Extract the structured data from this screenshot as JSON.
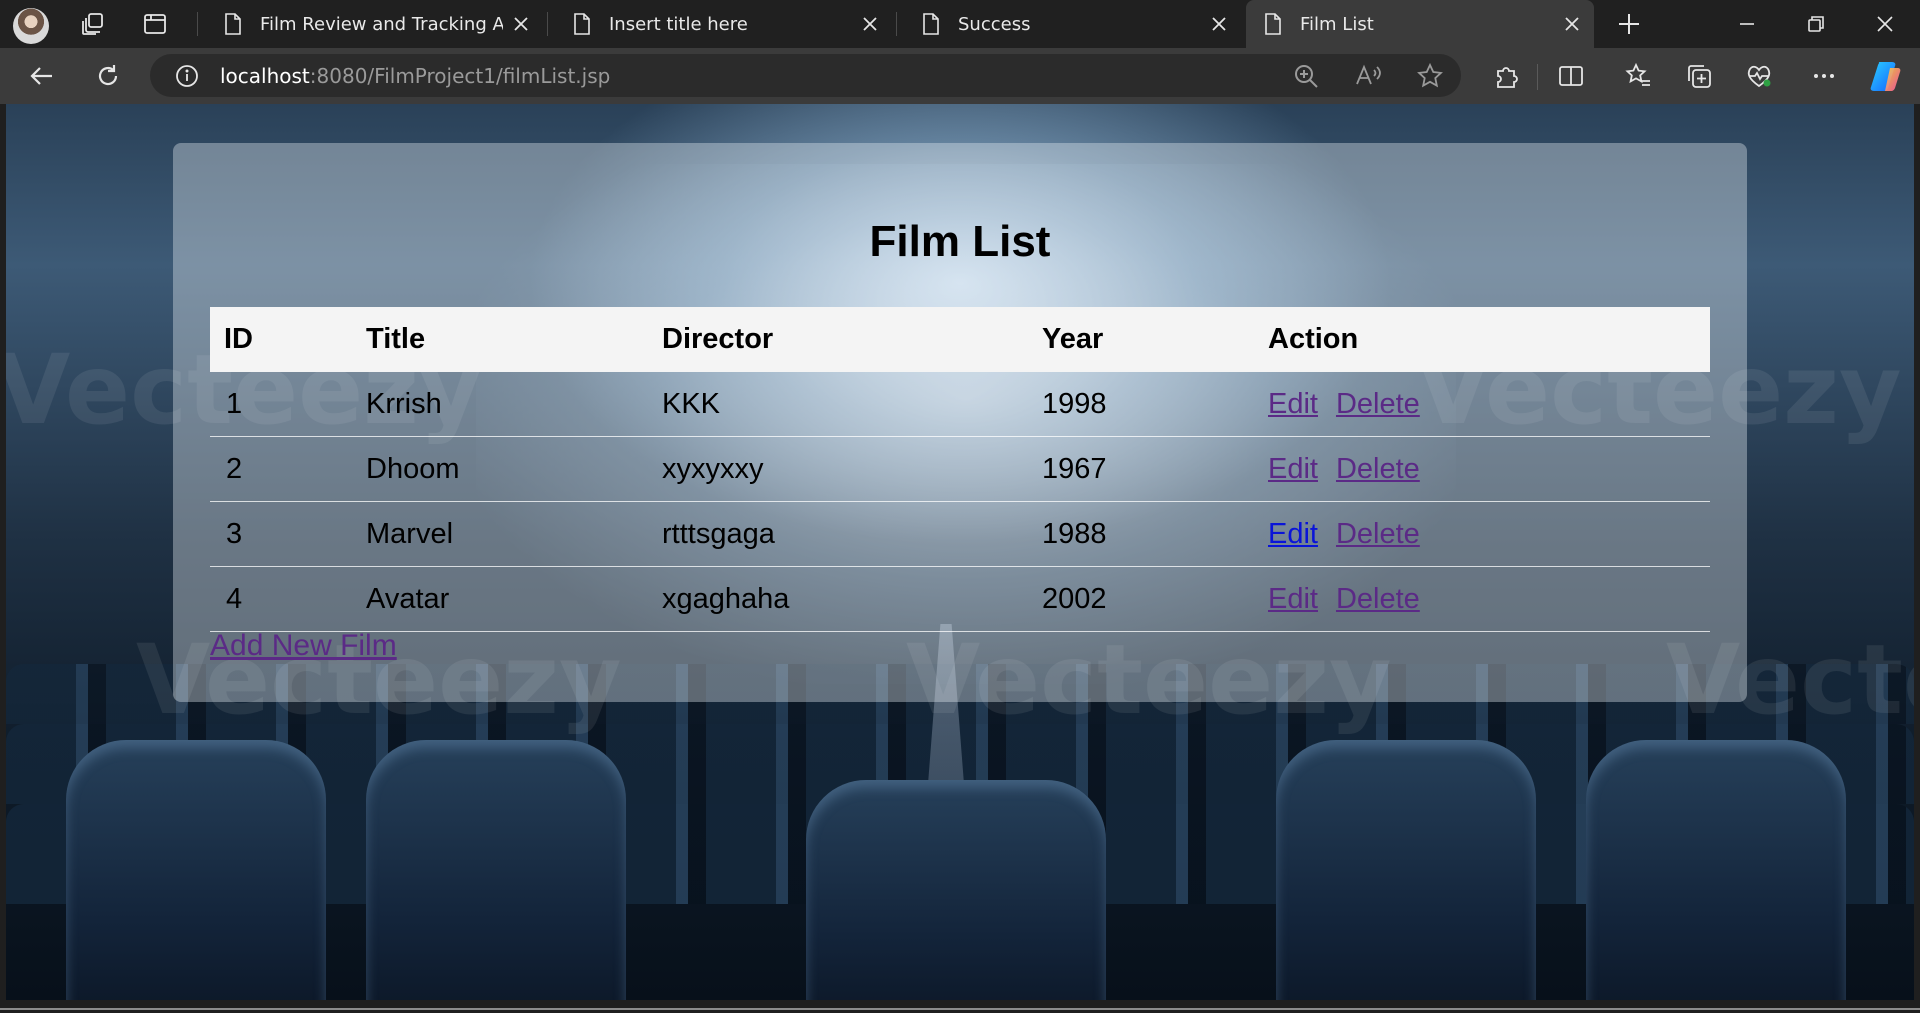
{
  "browser": {
    "tabs": [
      {
        "title": "Film Review and Tracking App",
        "active": false
      },
      {
        "title": "Insert title here",
        "active": false
      },
      {
        "title": "Success",
        "active": false
      },
      {
        "title": "Film List",
        "active": true
      }
    ],
    "address": {
      "host": "localhost",
      "path": ":8080/FilmProject1/filmList.jsp"
    }
  },
  "page": {
    "heading": "Film List",
    "table": {
      "headers": [
        "ID",
        "Title",
        "Director",
        "Year",
        "Action"
      ],
      "rows": [
        {
          "id": "1",
          "title": "Krrish",
          "director": "KKK",
          "year": "1998",
          "edit": "Edit",
          "delete": "Delete"
        },
        {
          "id": "2",
          "title": "Dhoom",
          "director": "xyxyxxy",
          "year": "1967",
          "edit": "Edit",
          "delete": "Delete"
        },
        {
          "id": "3",
          "title": "Marvel",
          "director": "rtttsgaga",
          "year": "1988",
          "edit": "Edit",
          "delete": "Delete"
        },
        {
          "id": "4",
          "title": "Avatar",
          "director": "xgaghaha",
          "year": "2002",
          "edit": "Edit",
          "delete": "Delete"
        }
      ]
    },
    "add_link": "Add New Film",
    "watermark": "Vecteezy"
  },
  "colors": {
    "visited_link": "#5b2a86",
    "active_link": "#0a14d8",
    "header_bg": "#f4f4f4"
  }
}
